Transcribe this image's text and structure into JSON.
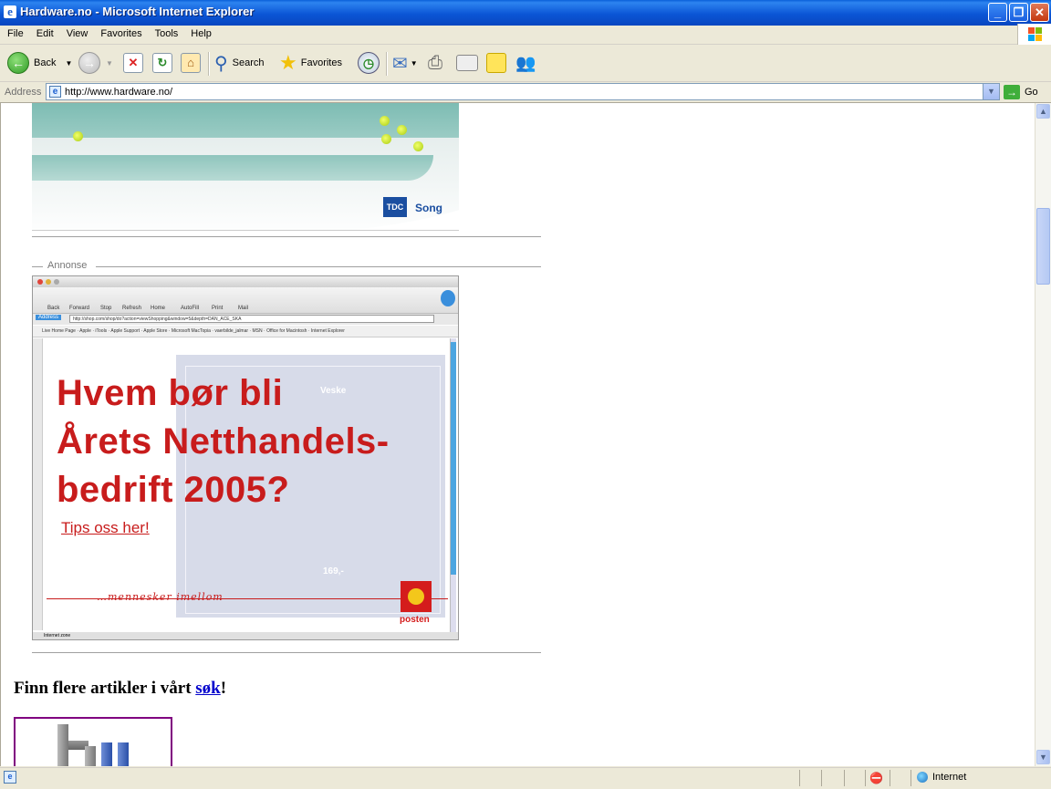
{
  "window": {
    "title": "Hardware.no - Microsoft Internet Explorer"
  },
  "menu": [
    "File",
    "Edit",
    "View",
    "Favorites",
    "Tools",
    "Help"
  ],
  "toolbar": {
    "back_label": "Back",
    "search_label": "Search",
    "favorites_label": "Favorites"
  },
  "address": {
    "label": "Address",
    "url": "http://www.hardware.no/",
    "go_label": "Go"
  },
  "content": {
    "top_banner": {
      "brand": "Song",
      "brand_logo_text": "TDC"
    },
    "annonse_label": "Annonse",
    "ad": {
      "headline_line1": "Hvem bør bli",
      "headline_line2": "Årets Netthandels-",
      "headline_line3": "bedrift 2005?",
      "link": "Tips oss her!",
      "tagline": "…mennesker imellom",
      "logo_text": "posten",
      "mock_browser": {
        "toolbar": [
          "Back",
          "Forward",
          "Stop",
          "Refresh",
          "Home",
          "AutoFill",
          "Print",
          "Mail"
        ],
        "address_label": "Address",
        "address_url": "http://shop.com/shop/do?action=viewShopping&window=5&depth=DAN_ACE_SKA",
        "links": [
          "Live Home Page",
          "Apple",
          "iTools",
          "Apple Support",
          "Apple Store",
          "Microsoft MacTopia",
          "vaerbilde_jalmar",
          "MSN",
          "Office for Macintosh",
          "Internet Explorer"
        ],
        "product_title": "Veske",
        "price": "169,-",
        "status": "Internet zone"
      }
    },
    "finn_prefix": "Finn flere artikler i vårt ",
    "finn_link": "søk",
    "finn_suffix": "!"
  },
  "status": {
    "zone": "Internet"
  }
}
